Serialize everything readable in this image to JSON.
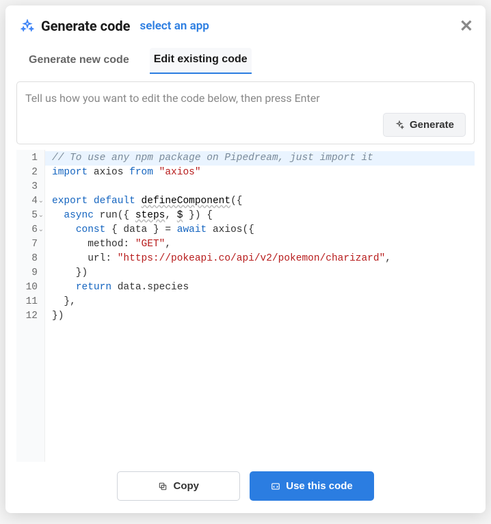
{
  "header": {
    "title": "Generate code",
    "select_app": "select an app"
  },
  "tabs": {
    "generate": "Generate new code",
    "edit": "Edit existing code"
  },
  "prompt": {
    "placeholder": "Tell us how you want to edit the code below, then press Enter",
    "generate_label": "Generate"
  },
  "code": {
    "lines": [
      {
        "n": 1,
        "fold": false,
        "hl": true,
        "segs": [
          {
            "t": "// To use any npm package on Pipedream, just import it",
            "c": "c-comment"
          }
        ]
      },
      {
        "n": 2,
        "fold": false,
        "segs": [
          {
            "t": "import",
            "c": "c-kw"
          },
          {
            "t": " axios ",
            "c": "c-id"
          },
          {
            "t": "from",
            "c": "c-kw"
          },
          {
            "t": " ",
            "c": ""
          },
          {
            "t": "\"axios\"",
            "c": "c-str"
          }
        ]
      },
      {
        "n": 3,
        "fold": false,
        "segs": []
      },
      {
        "n": 4,
        "fold": true,
        "segs": [
          {
            "t": "export",
            "c": "c-kw"
          },
          {
            "t": " ",
            "c": ""
          },
          {
            "t": "default",
            "c": "c-kw"
          },
          {
            "t": " ",
            "c": ""
          },
          {
            "t": "defineComponent",
            "c": "c-fn"
          },
          {
            "t": "({",
            "c": "c-id"
          }
        ]
      },
      {
        "n": 5,
        "fold": true,
        "segs": [
          {
            "t": "  ",
            "c": ""
          },
          {
            "t": "async",
            "c": "c-kw"
          },
          {
            "t": " run({ ",
            "c": "c-id"
          },
          {
            "t": "steps",
            "c": "c-fn"
          },
          {
            "t": ", ",
            "c": "c-id"
          },
          {
            "t": "$",
            "c": "c-fn"
          },
          {
            "t": " }) {",
            "c": "c-id"
          }
        ]
      },
      {
        "n": 6,
        "fold": true,
        "segs": [
          {
            "t": "    ",
            "c": ""
          },
          {
            "t": "const",
            "c": "c-kw"
          },
          {
            "t": " { data } = ",
            "c": "c-id"
          },
          {
            "t": "await",
            "c": "c-kw"
          },
          {
            "t": " axios({",
            "c": "c-id"
          }
        ]
      },
      {
        "n": 7,
        "fold": false,
        "segs": [
          {
            "t": "      method: ",
            "c": "c-id"
          },
          {
            "t": "\"GET\"",
            "c": "c-str"
          },
          {
            "t": ",",
            "c": "c-id"
          }
        ]
      },
      {
        "n": 8,
        "fold": false,
        "segs": [
          {
            "t": "      url: ",
            "c": "c-id"
          },
          {
            "t": "\"https://pokeapi.co/api/v2/pokemon/charizard\"",
            "c": "c-str"
          },
          {
            "t": ",",
            "c": "c-id"
          }
        ]
      },
      {
        "n": 9,
        "fold": false,
        "segs": [
          {
            "t": "    })",
            "c": "c-id"
          }
        ]
      },
      {
        "n": 10,
        "fold": false,
        "segs": [
          {
            "t": "    ",
            "c": ""
          },
          {
            "t": "return",
            "c": "c-kw"
          },
          {
            "t": " data.species",
            "c": "c-id"
          }
        ]
      },
      {
        "n": 11,
        "fold": false,
        "segs": [
          {
            "t": "  },",
            "c": "c-id"
          }
        ]
      },
      {
        "n": 12,
        "fold": false,
        "segs": [
          {
            "t": "})",
            "c": "c-id"
          }
        ]
      }
    ]
  },
  "footer": {
    "copy": "Copy",
    "use": "Use this code"
  }
}
